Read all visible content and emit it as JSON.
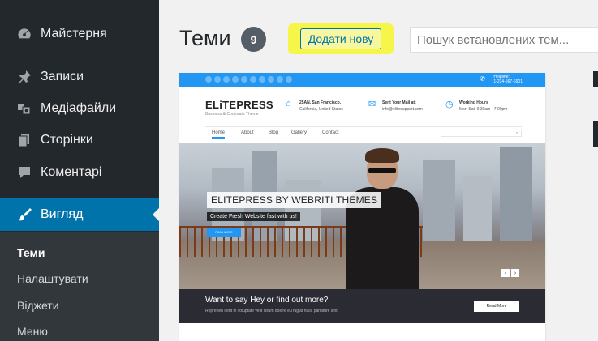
{
  "sidebar": {
    "items": [
      {
        "label": "Майстерня",
        "icon": "dashboard-icon"
      },
      {
        "label": "Записи",
        "icon": "pin-icon"
      },
      {
        "label": "Медіафайли",
        "icon": "media-icon"
      },
      {
        "label": "Сторінки",
        "icon": "pages-icon"
      },
      {
        "label": "Коментарі",
        "icon": "comment-icon"
      },
      {
        "label": "Вигляд",
        "icon": "brush-icon"
      }
    ],
    "submenu": [
      {
        "label": "Теми"
      },
      {
        "label": "Налаштувати"
      },
      {
        "label": "Віджети"
      },
      {
        "label": "Меню"
      }
    ]
  },
  "header": {
    "title": "Теми",
    "count": "9",
    "add_new": "Додати нову",
    "search_placeholder": "Пошук встановлених тем..."
  },
  "theme_preview": {
    "helpline_label": "Helpline:",
    "helpline_number": "1-234-567-6901",
    "brand": "ELiTEPRESS",
    "brand_sub": "Business & Corporate Theme",
    "info": [
      {
        "title": "25AN, San Francisco,",
        "text": "California, United States"
      },
      {
        "title": "Sent Your Mail at:",
        "text": "info@elitesupport.com"
      },
      {
        "title": "Working Hours",
        "text": "Mon-Sat: 9:30am - 7:00pm"
      }
    ],
    "nav": [
      "Home",
      "About",
      "Blog",
      "Gallery",
      "Contact"
    ],
    "hero_title": "ELITEPRESS BY WEBRITI THEMES",
    "hero_sub": "Create Fresh Website fast  with us!",
    "hero_button": "READ MORE",
    "cta_title": "Want to say Hey or find out more?",
    "cta_text": "Reprehen derit in voluptate velit cillum dolore eu fugiat nulla pariature  sint.",
    "cta_button": "Read More"
  },
  "colors": {
    "sidebar_bg": "#23282d",
    "active_bg": "#0073aa",
    "highlight": "#f6f64a",
    "theme_accent": "#2196f3"
  }
}
